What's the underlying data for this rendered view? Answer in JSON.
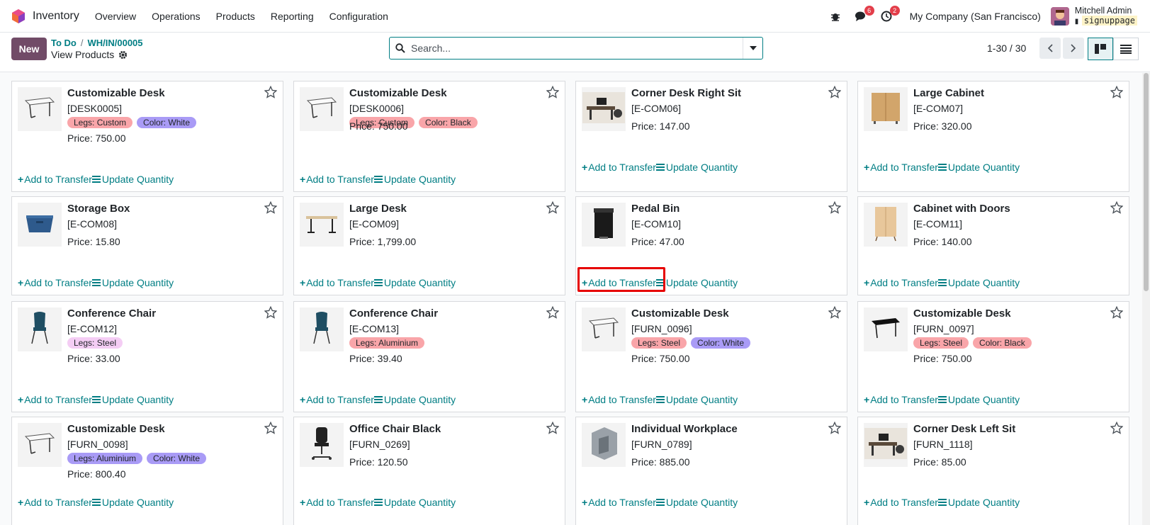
{
  "nav": {
    "app_name": "Inventory",
    "menu": [
      "Overview",
      "Operations",
      "Products",
      "Reporting",
      "Configuration"
    ],
    "messages_badge": "6",
    "activities_badge": "2",
    "company": "My Company (San Francisco)",
    "user_name": "Mitchell Admin",
    "database": "signuppage"
  },
  "control": {
    "new_label": "New",
    "breadcrumb_1": "To Do",
    "breadcrumb_2": "WH/IN/00005",
    "view_title": "View Products",
    "search_placeholder": "Search...",
    "pager": "1-30 / 30"
  },
  "actions": {
    "add": "Add to Transfer",
    "update": "Update Quantity"
  },
  "colors": {
    "accent": "#017e84",
    "brand": "#714b67",
    "tag_red": "#f9a5a9",
    "tag_purple": "#a99bf6",
    "tag_pink": "#f4cdf4"
  },
  "products": [
    {
      "name": "Customizable Desk",
      "code": "[DESK0005]",
      "tags": [
        {
          "label": "Legs: Custom",
          "color": "red"
        },
        {
          "label": "Color: White",
          "color": "purple"
        }
      ],
      "price": "Price: 750.00",
      "image": "desk-white-icon"
    },
    {
      "name": "Customizable Desk",
      "code": "[DESK0006]",
      "tags": [
        {
          "label": "Legs: Custom",
          "color": "red"
        },
        {
          "label": "Color: Black",
          "color": "red"
        }
      ],
      "price": "Price: 750.00",
      "image": "desk-white-icon"
    },
    {
      "name": "Corner Desk Right Sit",
      "code": "[E-COM06]",
      "tags": [],
      "price": "Price: 147.00",
      "image": "office-desk-photo"
    },
    {
      "name": "Large Cabinet",
      "code": "[E-COM07]",
      "tags": [],
      "price": "Price: 320.00",
      "image": "cabinet-icon"
    },
    {
      "name": "Storage Box",
      "code": "[E-COM08]",
      "tags": [],
      "price": "Price: 15.80",
      "image": "storage-box-icon"
    },
    {
      "name": "Large Desk",
      "code": "[E-COM09]",
      "tags": [],
      "price": "Price: 1,799.00",
      "image": "large-desk-icon"
    },
    {
      "name": "Pedal Bin",
      "code": "[E-COM10]",
      "tags": [],
      "price": "Price: 47.00",
      "image": "pedal-bin-icon"
    },
    {
      "name": "Cabinet with Doors",
      "code": "[E-COM11]",
      "tags": [],
      "price": "Price: 140.00",
      "image": "cabinet-doors-icon"
    },
    {
      "name": "Conference Chair",
      "code": "[E-COM12]",
      "tags": [
        {
          "label": "Legs: Steel",
          "color": "pink"
        }
      ],
      "price": "Price: 33.00",
      "image": "chair-icon"
    },
    {
      "name": "Conference Chair",
      "code": "[E-COM13]",
      "tags": [
        {
          "label": "Legs: Aluminium",
          "color": "red"
        }
      ],
      "price": "Price: 39.40",
      "image": "chair-icon"
    },
    {
      "name": "Customizable Desk",
      "code": "[FURN_0096]",
      "tags": [
        {
          "label": "Legs: Steel",
          "color": "red"
        },
        {
          "label": "Color: White",
          "color": "purple"
        }
      ],
      "price": "Price: 750.00",
      "image": "desk-white-icon"
    },
    {
      "name": "Customizable Desk",
      "code": "[FURN_0097]",
      "tags": [
        {
          "label": "Legs: Steel",
          "color": "red"
        },
        {
          "label": "Color: Black",
          "color": "red"
        }
      ],
      "price": "Price: 750.00",
      "image": "desk-black-icon"
    },
    {
      "name": "Customizable Desk",
      "code": "[FURN_0098]",
      "tags": [
        {
          "label": "Legs: Aluminium",
          "color": "purple"
        },
        {
          "label": "Color: White",
          "color": "purple"
        }
      ],
      "price": "Price: 800.40",
      "image": "desk-white-icon"
    },
    {
      "name": "Office Chair Black",
      "code": "[FURN_0269]",
      "tags": [],
      "price": "Price: 120.50",
      "image": "office-chair-icon"
    },
    {
      "name": "Individual Workplace",
      "code": "[FURN_0789]",
      "tags": [],
      "price": "Price: 885.00",
      "image": "workplace-icon"
    },
    {
      "name": "Corner Desk Left Sit",
      "code": "[FURN_1118]",
      "tags": [],
      "price": "Price: 85.00",
      "image": "office-desk-photo"
    }
  ]
}
